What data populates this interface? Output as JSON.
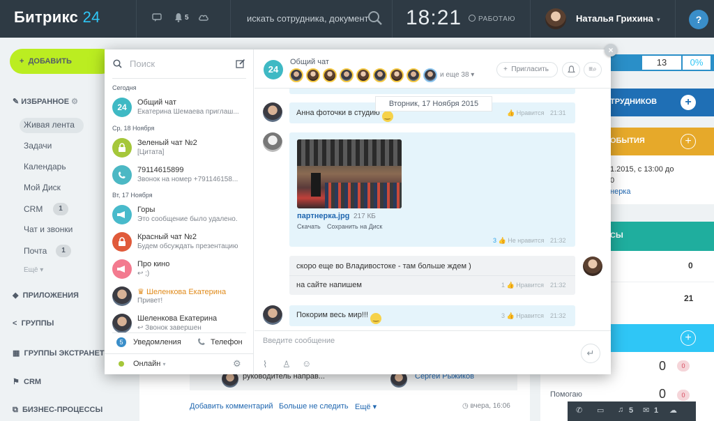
{
  "topbar": {
    "logo_main": "Битрикс",
    "logo_num": "24",
    "notif_count": "5",
    "search_placeholder": "искать сотрудника, документ",
    "time": "18:21",
    "work_status": "РАБОТАЮ",
    "user_name": "Наталья Грихина",
    "help": "?"
  },
  "sidebar": {
    "add_button": "ДОБАВИТЬ",
    "favorites": "ИЗБРАННОЕ",
    "items": [
      {
        "label": "Живая лента",
        "count": ""
      },
      {
        "label": "Задачи",
        "count": ""
      },
      {
        "label": "Календарь",
        "count": ""
      },
      {
        "label": "Мой Диск",
        "count": ""
      },
      {
        "label": "CRM",
        "count": "1"
      },
      {
        "label": "Чат и звонки",
        "count": ""
      },
      {
        "label": "Почта",
        "count": "1"
      }
    ],
    "more": "Ещё",
    "sections": [
      "ПРИЛОЖЕНИЯ",
      "ГРУППЫ",
      "ГРУППЫ ЭКСТРАНЕТ",
      "CRM",
      "БИЗНЕС-ПРОЦЕССЫ"
    ]
  },
  "background": {
    "feed_author_role": "руководитель направ...",
    "feed_author_name": "Сергей Рыжиков",
    "add_comment": "Добавить комментарий",
    "unfollow": "Больше не следить",
    "more": "Ещё",
    "feed_time": "вчера, 16:06",
    "right_stats": {
      "a": "13",
      "b": "0%"
    },
    "card_employees": "ТРУДНИКОВ",
    "card_events": "ОБЫТИЯ",
    "event_text": "1.2015, с 13:00 до",
    "event_text2": "0",
    "event_link": "нерка",
    "card_green": "СЫ",
    "val1": "0",
    "val2": "21",
    "row_zero_1": "0",
    "badge_1": "0",
    "helping_label": "Помогаю",
    "row_zero_2": "0",
    "badge_2": "0"
  },
  "bottombar": {
    "notif": "5",
    "mail": "1"
  },
  "chat": {
    "search_placeholder": "Поиск",
    "groups": [
      "Сегодня",
      "Ср, 18 Ноября",
      "Вт, 17 Ноября"
    ],
    "contacts": [
      {
        "title": "Общий чат",
        "sub": "Екатерина Шемаева приглаш...",
        "color": "#3fb9c4",
        "glyph": "24"
      },
      {
        "title": "Зеленый чат №2",
        "sub": "[Цитата]",
        "color": "#a5c73a",
        "glyph": "🔒"
      },
      {
        "title": "79114615899",
        "sub": "Звонок на номер +791146158...",
        "color": "#4cb8c4",
        "glyph": "✆"
      },
      {
        "title": "Горы",
        "sub": "Это сообщение было удалено.",
        "color": "#48bacb",
        "glyph": "📢"
      },
      {
        "title": "Красный чат №2",
        "sub": "Будем обсуждать презентацию",
        "color": "#e05a3a",
        "glyph": "🔒"
      },
      {
        "title": "Про кино",
        "sub": "↩ ;)",
        "color": "#f37a8f",
        "glyph": "📢"
      },
      {
        "title": "Шеленкова Екатерина",
        "sub": "Привет!",
        "color": "",
        "glyph": ""
      },
      {
        "title": "Шеленкова Екатерина",
        "sub": "↩ Звонок завершен",
        "color": "",
        "glyph": ""
      }
    ],
    "notifications_count": "5",
    "notifications": "Уведомления",
    "phone": "Телефон",
    "status": "Онлайн",
    "header": {
      "badge": "24",
      "name": "Общий чат",
      "more_members": "и еще 38",
      "invite": "Пригласить"
    },
    "date_label": "Вторник, 17 Ноября 2015",
    "messages": [
      {
        "text": "Анна фоточки в студию",
        "likes": "",
        "like_label": "Нравится",
        "time": "21:31"
      },
      {
        "file_name": "партнерка.jpg",
        "file_size": "217 КБ",
        "download": "Скачать",
        "save": "Сохранить на Диск",
        "likes": "3",
        "like_label": "Не нравится",
        "time": "21:32"
      },
      {
        "text": "скоро еще во Владивостоке - там больше ждем )",
        "text2": "на сайте напишем",
        "likes": "1",
        "like_label": "Нравится",
        "time": "21:32"
      },
      {
        "text": "Покорим весь мир!!!",
        "likes": "3",
        "like_label": "Нравится",
        "time": "21:32"
      }
    ],
    "input_placeholder": "Введите сообщение"
  }
}
